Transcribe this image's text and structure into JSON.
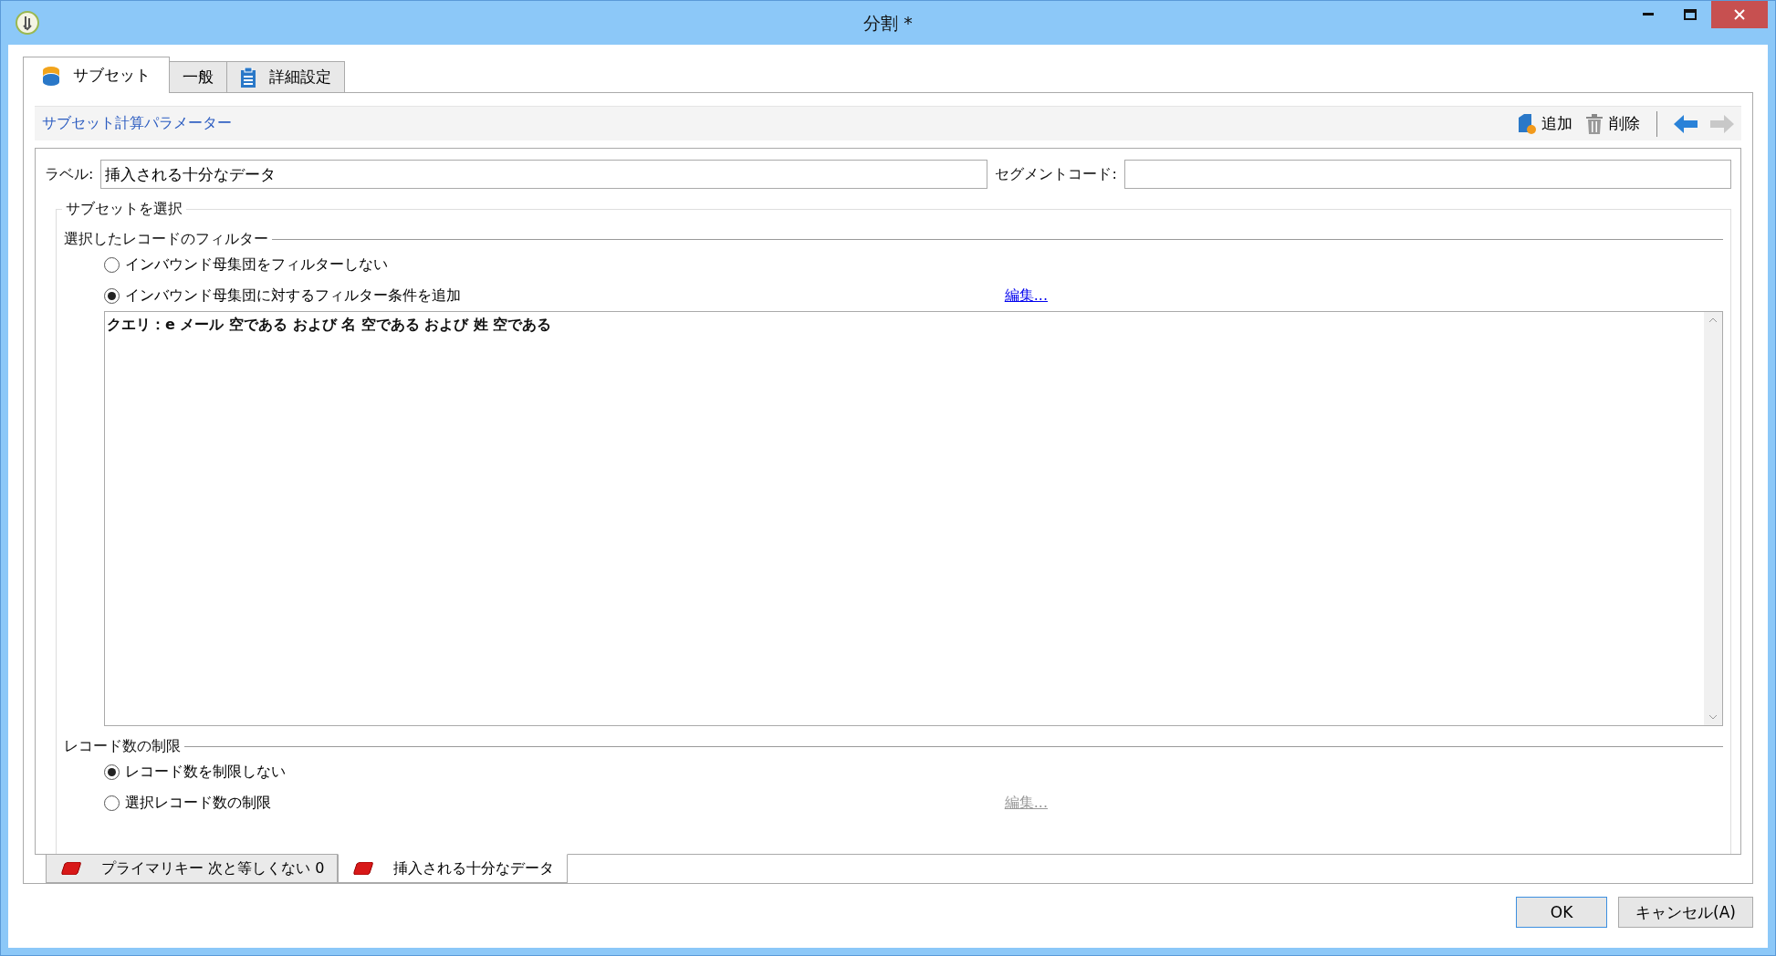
{
  "window": {
    "title": "分割 *"
  },
  "tabs": [
    {
      "label": "サブセット",
      "kind": "database",
      "selected": true
    },
    {
      "label": "一般",
      "kind": "plain",
      "selected": false
    },
    {
      "label": "詳細設定",
      "kind": "clipboard",
      "selected": false
    }
  ],
  "section": {
    "title": "サブセット計算パラメーター"
  },
  "toolbar": {
    "buttons": [
      {
        "kind": "add",
        "label": "追加"
      },
      {
        "kind": "delete",
        "label": "削除"
      }
    ],
    "nav": [
      {
        "kind": "back",
        "disabled": false
      },
      {
        "kind": "forward",
        "disabled": true
      }
    ]
  },
  "fields": [
    {
      "label": "ラベル:",
      "value": "挿入される十分なデータ"
    },
    {
      "label": "セグメントコード:"
    }
  ],
  "group": {
    "title": "サブセットを選択",
    "filter": {
      "title": "選択したレコードのフィルター",
      "options": [
        {
          "label": "インバウンド母集団をフィルターしない",
          "selected": false
        },
        {
          "label": "インバウンド母集団に対するフィルター条件を追加",
          "selected": true
        }
      ],
      "edit_link": {
        "label": "編集...",
        "disabled": false
      },
      "query": "クエリ：e メール 空である および 名 空である および 姓 空である"
    },
    "limit": {
      "title": "レコード数の制限",
      "options": [
        {
          "label": "レコード数を制限しない",
          "selected": true
        },
        {
          "label": "選択レコード数の制限",
          "selected": false
        }
      ],
      "edit_link": {
        "label": "編集...",
        "disabled": true
      }
    }
  },
  "subset_tabs": [
    {
      "label": "プライマリキー 次と等しくない 0",
      "selected": false
    },
    {
      "label": "挿入される十分なデータ",
      "selected": true
    }
  ],
  "buttons": [
    {
      "label": "OK",
      "default": true
    },
    {
      "label": "キャンセル(A)",
      "default": false
    }
  ]
}
